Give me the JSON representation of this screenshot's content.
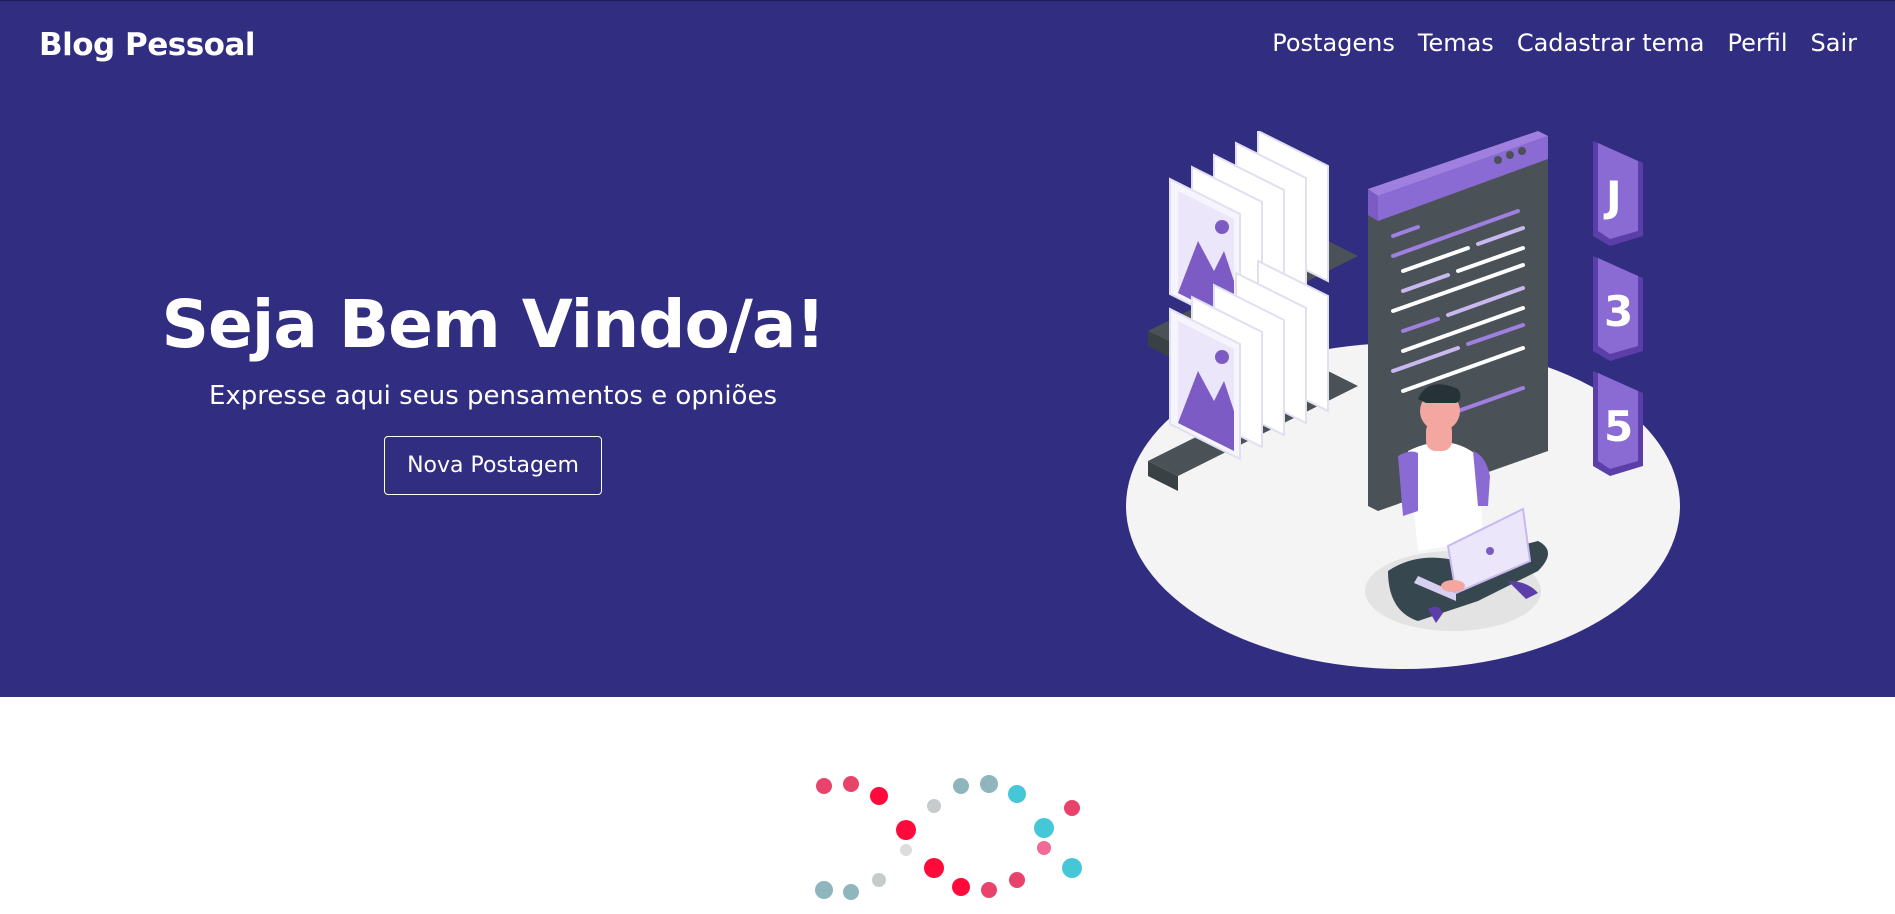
{
  "navbar": {
    "brand": "Blog Pessoal",
    "links": [
      "Postagens",
      "Temas",
      "Cadastrar tema",
      "Perfil",
      "Sair"
    ]
  },
  "hero": {
    "title": "Seja Bem Vindo/a!",
    "subtitle": "Expresse aqui seus pensamentos e opniões",
    "button_label": "Nova Postagem",
    "illustration_icons": [
      "js-badge-icon",
      "css3-badge-icon",
      "html5-badge-icon",
      "code-window-icon",
      "image-gallery-icon",
      "person-with-laptop-icon"
    ]
  },
  "colors": {
    "hero_bg": "#312d81",
    "accent_purple": "#7c5cc4",
    "text": "#ffffff"
  },
  "loader": {
    "icon": "dots-loading-icon",
    "colors": [
      "#e8446b",
      "#ff0a3b",
      "#8fb5bd",
      "#c6cccc",
      "#46c7d8",
      "#f06b95"
    ]
  }
}
